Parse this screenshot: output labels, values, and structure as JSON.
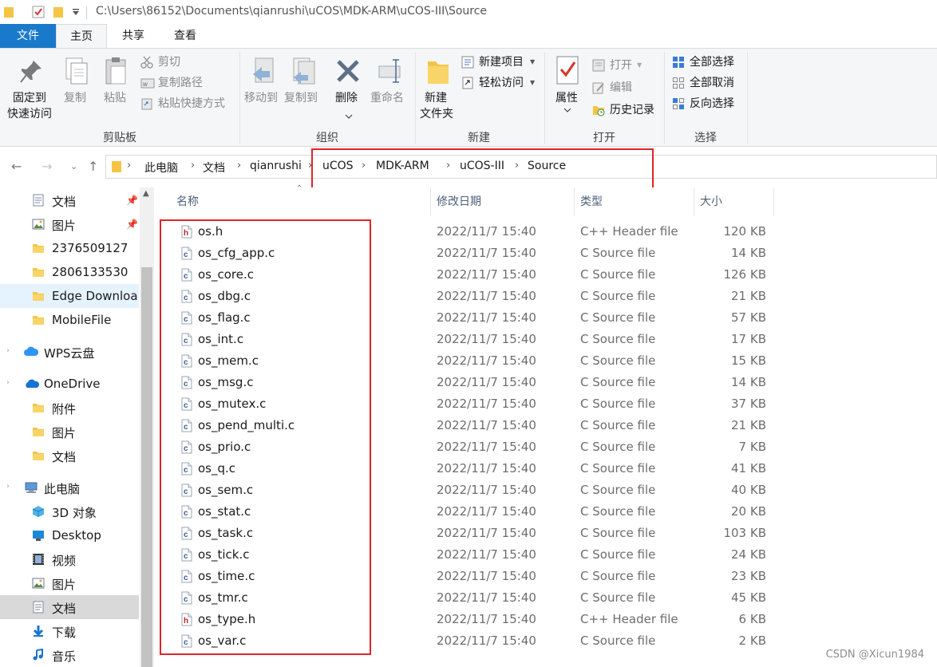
{
  "window": {
    "path": "C:\\Users\\86152\\Documents\\qianrushi\\uCOS\\MDK-ARM\\uCOS-III\\Source"
  },
  "tabs": [
    "文件",
    "主页",
    "共享",
    "查看"
  ],
  "ribbon": {
    "clipboard": {
      "pin_label_1": "固定到",
      "pin_label_2": "快速访问",
      "copy": "复制",
      "paste": "粘贴",
      "cut": "剪切",
      "copy_path": "复制路径",
      "paste_shortcut": "粘贴快捷方式",
      "group": "剪贴板"
    },
    "organize": {
      "move_to": "移动到",
      "copy_to": "复制到",
      "delete": "删除",
      "rename": "重命名",
      "group": "组织"
    },
    "new": {
      "new_folder_1": "新建",
      "new_folder_2": "文件夹",
      "new_item": "新建项目",
      "easy_access": "轻松访问",
      "group": "新建"
    },
    "open": {
      "properties": "属性",
      "open": "打开",
      "edit": "编辑",
      "history": "历史记录",
      "group": "打开"
    },
    "select": {
      "select_all": "全部选择",
      "select_none": "全部取消",
      "invert": "反向选择",
      "group": "选择"
    }
  },
  "breadcrumb": [
    "此电脑",
    "文档",
    "qianrushi",
    "uCOS",
    "MDK-ARM",
    "uCOS-III",
    "Source"
  ],
  "nav": [
    {
      "label": "文档",
      "icon": "documents-icon",
      "pinned": true
    },
    {
      "label": "图片",
      "icon": "pictures-icon",
      "pinned": true
    },
    {
      "label": "2376509127",
      "icon": "folder-icon"
    },
    {
      "label": "2806133530",
      "icon": "folder-icon"
    },
    {
      "label": "Edge  Downloa",
      "icon": "folder-icon"
    },
    {
      "label": "MobileFile",
      "icon": "folder-icon"
    },
    {
      "label": "WPS云盘",
      "icon": "cloud-icon"
    },
    {
      "label": "OneDrive",
      "icon": "onedrive-icon"
    },
    {
      "label": "附件",
      "icon": "folder-icon"
    },
    {
      "label": "图片",
      "icon": "folder-icon"
    },
    {
      "label": "文档",
      "icon": "folder-icon"
    },
    {
      "label": "此电脑",
      "icon": "computer-icon"
    },
    {
      "label": "3D 对象",
      "icon": "3d-objects-icon"
    },
    {
      "label": "Desktop",
      "icon": "desktop-icon"
    },
    {
      "label": "视频",
      "icon": "videos-icon"
    },
    {
      "label": "图片",
      "icon": "pictures-icon"
    },
    {
      "label": "文档",
      "icon": "documents-icon"
    },
    {
      "label": "下载",
      "icon": "downloads-icon"
    },
    {
      "label": "音乐",
      "icon": "music-icon"
    }
  ],
  "columns": {
    "name": "名称",
    "date": "修改日期",
    "type": "类型",
    "size": "大小"
  },
  "files": [
    {
      "name": "os.h",
      "date": "2022/11/7 15:40",
      "type": "C++ Header file",
      "size": "120 KB",
      "kind": "h"
    },
    {
      "name": "os_cfg_app.c",
      "date": "2022/11/7 15:40",
      "type": "C Source file",
      "size": "14 KB",
      "kind": "c"
    },
    {
      "name": "os_core.c",
      "date": "2022/11/7 15:40",
      "type": "C Source file",
      "size": "126 KB",
      "kind": "c"
    },
    {
      "name": "os_dbg.c",
      "date": "2022/11/7 15:40",
      "type": "C Source file",
      "size": "21 KB",
      "kind": "c"
    },
    {
      "name": "os_flag.c",
      "date": "2022/11/7 15:40",
      "type": "C Source file",
      "size": "57 KB",
      "kind": "c"
    },
    {
      "name": "os_int.c",
      "date": "2022/11/7 15:40",
      "type": "C Source file",
      "size": "17 KB",
      "kind": "c"
    },
    {
      "name": "os_mem.c",
      "date": "2022/11/7 15:40",
      "type": "C Source file",
      "size": "15 KB",
      "kind": "c"
    },
    {
      "name": "os_msg.c",
      "date": "2022/11/7 15:40",
      "type": "C Source file",
      "size": "14 KB",
      "kind": "c"
    },
    {
      "name": "os_mutex.c",
      "date": "2022/11/7 15:40",
      "type": "C Source file",
      "size": "37 KB",
      "kind": "c"
    },
    {
      "name": "os_pend_multi.c",
      "date": "2022/11/7 15:40",
      "type": "C Source file",
      "size": "21 KB",
      "kind": "c"
    },
    {
      "name": "os_prio.c",
      "date": "2022/11/7 15:40",
      "type": "C Source file",
      "size": "7 KB",
      "kind": "c"
    },
    {
      "name": "os_q.c",
      "date": "2022/11/7 15:40",
      "type": "C Source file",
      "size": "41 KB",
      "kind": "c"
    },
    {
      "name": "os_sem.c",
      "date": "2022/11/7 15:40",
      "type": "C Source file",
      "size": "40 KB",
      "kind": "c"
    },
    {
      "name": "os_stat.c",
      "date": "2022/11/7 15:40",
      "type": "C Source file",
      "size": "20 KB",
      "kind": "c"
    },
    {
      "name": "os_task.c",
      "date": "2022/11/7 15:40",
      "type": "C Source file",
      "size": "103 KB",
      "kind": "c"
    },
    {
      "name": "os_tick.c",
      "date": "2022/11/7 15:40",
      "type": "C Source file",
      "size": "24 KB",
      "kind": "c"
    },
    {
      "name": "os_time.c",
      "date": "2022/11/7 15:40",
      "type": "C Source file",
      "size": "23 KB",
      "kind": "c"
    },
    {
      "name": "os_tmr.c",
      "date": "2022/11/7 15:40",
      "type": "C Source file",
      "size": "45 KB",
      "kind": "c"
    },
    {
      "name": "os_type.h",
      "date": "2022/11/7 15:40",
      "type": "C++ Header file",
      "size": "6 KB",
      "kind": "h"
    },
    {
      "name": "os_var.c",
      "date": "2022/11/7 15:40",
      "type": "C Source file",
      "size": "2 KB",
      "kind": "c"
    }
  ],
  "watermark": "CSDN @Xicun1984",
  "colors": {
    "accent": "#1979ca",
    "highlight": "#e0242a",
    "folder": "#f6c445"
  }
}
